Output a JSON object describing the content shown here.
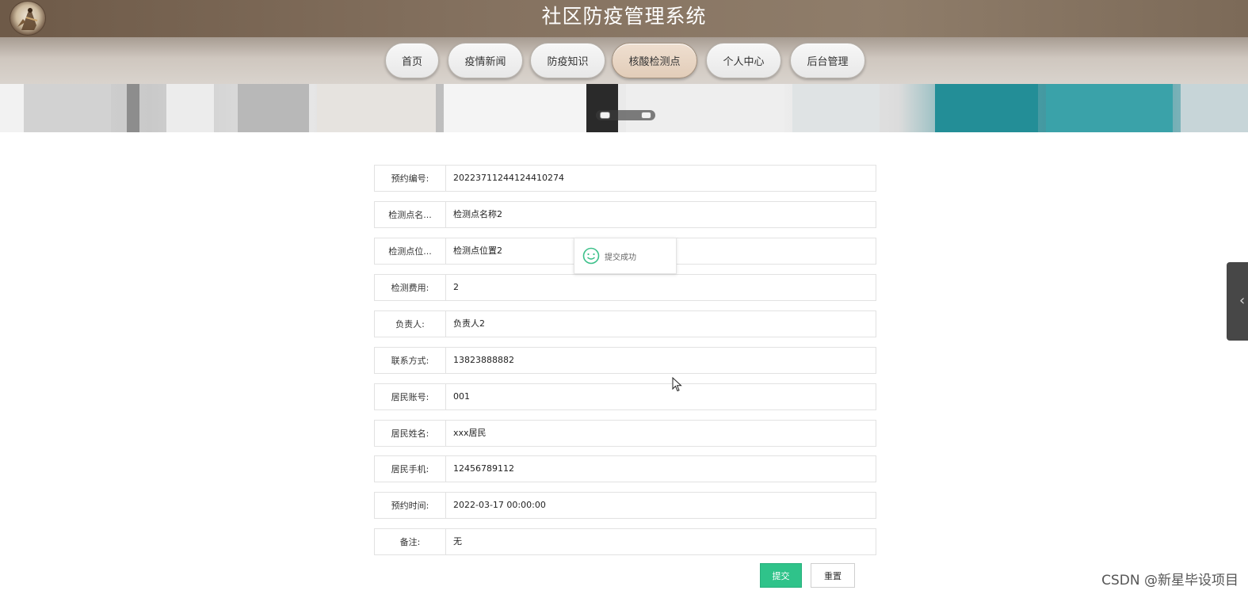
{
  "header": {
    "title": "社区防疫管理系统"
  },
  "nav": {
    "items": [
      {
        "label": "首页"
      },
      {
        "label": "疫情新闻"
      },
      {
        "label": "防疫知识"
      },
      {
        "label": "核酸检测点",
        "active": true
      },
      {
        "label": "个人中心"
      },
      {
        "label": "后台管理"
      }
    ]
  },
  "form": {
    "rows": [
      {
        "label": "预约编号:",
        "value": "20223711244124410274"
      },
      {
        "label": "检测点名...",
        "value": "检测点名称2"
      },
      {
        "label": "检测点位...",
        "value": "检测点位置2"
      },
      {
        "label": "检测费用:",
        "value": "2"
      },
      {
        "label": "负责人:",
        "value": "负责人2"
      },
      {
        "label": "联系方式:",
        "value": "13823888882"
      },
      {
        "label": "居民账号:",
        "value": "001"
      },
      {
        "label": "居民姓名:",
        "value": "xxx居民"
      },
      {
        "label": "居民手机:",
        "value": "12456789112"
      },
      {
        "label": "预约时间:",
        "value": "2022-03-17 00:00:00"
      },
      {
        "label": "备注:",
        "value": "无"
      }
    ],
    "submit_label": "提交",
    "reset_label": "重置"
  },
  "toast": {
    "message": "提交成功",
    "icon": "smile-icon"
  },
  "side_tab": {
    "icon": "chevron-left-icon",
    "glyph": "‹"
  },
  "watermark": "CSDN @新星毕设项目",
  "colors": {
    "accent_green": "#2fc38a",
    "header_brown": "#857260",
    "active_tab": "#e2cdb9"
  }
}
